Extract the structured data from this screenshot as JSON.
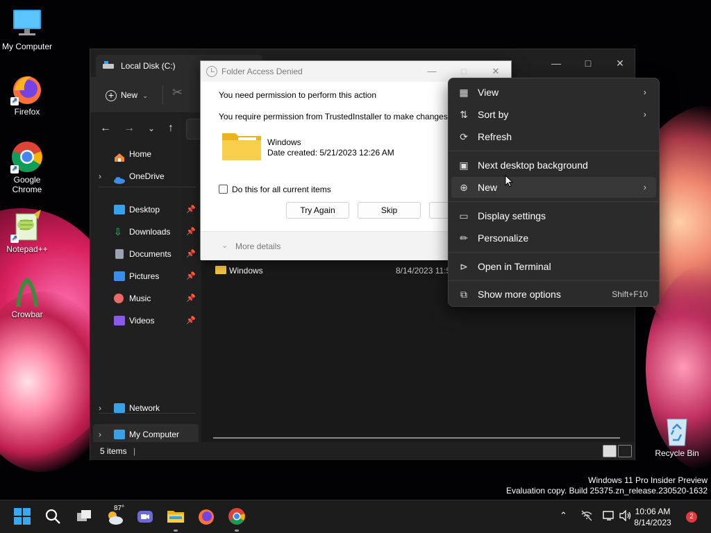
{
  "desktop": {
    "icons": [
      {
        "label": "My Computer"
      },
      {
        "label": "Firefox"
      },
      {
        "label": "Google Chrome"
      },
      {
        "label": "Notepad++"
      },
      {
        "label": "Crowbar"
      },
      {
        "label": "Recycle Bin"
      }
    ],
    "watermark": {
      "line1": "Windows 11 Pro Insider Preview",
      "line2": "Evaluation copy. Build 25375.zn_release.230520-1632"
    }
  },
  "explorer": {
    "tab_title": "Local Disk (C:)",
    "toolbar": {
      "new_label": "New"
    },
    "sidebar": {
      "items": [
        {
          "label": "Home"
        },
        {
          "label": "OneDrive"
        },
        {
          "label": "Desktop"
        },
        {
          "label": "Downloads"
        },
        {
          "label": "Documents"
        },
        {
          "label": "Pictures"
        },
        {
          "label": "Music"
        },
        {
          "label": "Videos"
        },
        {
          "label": "My Computer"
        },
        {
          "label": "Network"
        }
      ]
    },
    "files": [
      {
        "name": "Windows",
        "date": "8/14/2023 11:5"
      }
    ],
    "status": {
      "count": "5 items"
    }
  },
  "dialog": {
    "title": "Folder Access Denied",
    "message1": "You need permission to perform this action",
    "message2": "You require permission from TrustedInstaller to make changes t",
    "folder_name": "Windows",
    "folder_date": "Date created: 5/21/2023 12:26 AM",
    "checkbox_label": "Do this for all current items",
    "buttons": {
      "try_again": "Try Again",
      "skip": "Skip"
    },
    "more_details": "More details"
  },
  "context_menu": {
    "items": [
      {
        "label": "View",
        "icon": "grid-icon"
      },
      {
        "label": "Sort by",
        "icon": "sort-icon"
      },
      {
        "label": "Refresh",
        "icon": "refresh-icon"
      },
      {
        "label": "Next desktop background",
        "icon": "image-icon"
      },
      {
        "label": "New",
        "icon": "plus-circle-icon"
      },
      {
        "label": "Display settings",
        "icon": "display-icon"
      },
      {
        "label": "Personalize",
        "icon": "brush-icon"
      },
      {
        "label": "Open in Terminal",
        "icon": "terminal-icon"
      },
      {
        "label": "Show more options",
        "icon": "share-icon",
        "shortcut": "Shift+F10"
      }
    ]
  },
  "taskbar": {
    "weather_temp": "87°",
    "time": "10:06 AM",
    "date": "8/14/2023",
    "notification_count": "2"
  },
  "colors": {
    "accent": "#0078d4",
    "folder": "#f4c542",
    "notif": "#e03a3a"
  }
}
